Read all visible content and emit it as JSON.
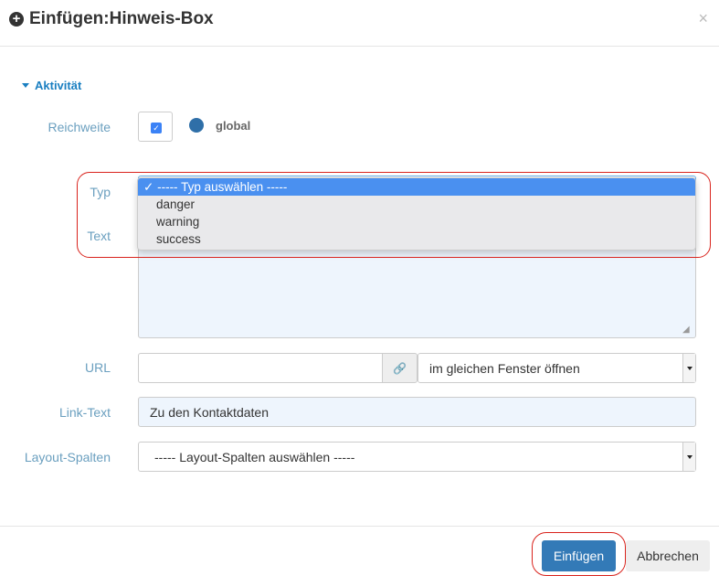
{
  "dialog": {
    "title": "Einfügen:Hinweis-Box",
    "close": "×"
  },
  "section": {
    "label": "Aktivität"
  },
  "reichweite": {
    "label": "Reichweite",
    "checked": true,
    "value": "global",
    "icon": "globe-icon"
  },
  "typ": {
    "label": "Typ",
    "options": [
      "----- Typ auswählen -----",
      "danger",
      "warning",
      "success"
    ],
    "selected": "----- Typ auswählen -----",
    "check": "✓"
  },
  "text": {
    "label": "Text",
    "value": ""
  },
  "url": {
    "label": "URL",
    "value": "",
    "target": "im gleichen Fenster öffnen"
  },
  "linktext": {
    "label": "Link-Text",
    "value": "Zu den Kontaktdaten"
  },
  "layout": {
    "label": "Layout-Spalten",
    "value": "----- Layout-Spalten auswählen -----"
  },
  "footer": {
    "insert": "Einfügen",
    "cancel": "Abbrechen"
  },
  "colors": {
    "primary": "#337ab7",
    "accent": "#1a7fc1",
    "highlight": "#d9231c",
    "menu_selected": "#4a90f0"
  }
}
